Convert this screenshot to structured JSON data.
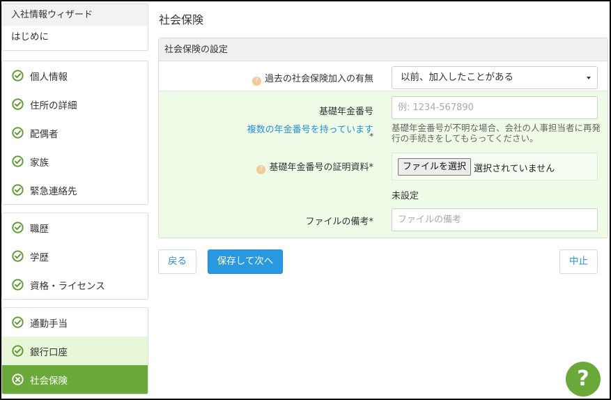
{
  "wizard": {
    "title": "入社情報ウィザード",
    "intro": "はじめに"
  },
  "sidebar": {
    "group1": [
      {
        "label": "個人情報",
        "status": "done"
      },
      {
        "label": "住所の詳細",
        "status": "done"
      },
      {
        "label": "配偶者",
        "status": "done"
      },
      {
        "label": "家族",
        "status": "done"
      },
      {
        "label": "緊急連絡先",
        "status": "done"
      }
    ],
    "group2": [
      {
        "label": "職歴",
        "status": "done"
      },
      {
        "label": "学歴",
        "status": "done"
      },
      {
        "label": "資格・ライセンス",
        "status": "done"
      }
    ],
    "group3": [
      {
        "label": "通勤手当",
        "status": "done"
      },
      {
        "label": "銀行口座",
        "status": "done"
      },
      {
        "label": "社会保険",
        "status": "error"
      }
    ]
  },
  "main": {
    "title": "社会保険",
    "section_title": "社会保険の設定",
    "past_enrollment": {
      "label": "過去の社会保険加入の有無",
      "value": "以前、加入したことがある"
    },
    "pension_number": {
      "label": "基礎年金番号",
      "placeholder": "例: 1234-567890",
      "multiple_link": "複数の年金番号を持っています",
      "required_mark": "*",
      "help": "基礎年金番号が不明な場合、会社の人事担当者に再発行の手続きをしてもらってください。"
    },
    "proof_document": {
      "label": "基礎年金番号の証明資料*",
      "file_button": "ファイルを選択",
      "file_status": "選択されていません",
      "current": "未設定"
    },
    "file_note": {
      "label": "ファイルの備考*",
      "placeholder": "ファイルの備考"
    }
  },
  "actions": {
    "back": "戻る",
    "save_next": "保存して次へ",
    "cancel": "中止"
  },
  "help_button": "?",
  "colors": {
    "accent_green": "#6ba83a",
    "primary_blue": "#2898e0",
    "link_blue": "#2a8fd3",
    "form_bg": "#eefbe7"
  }
}
